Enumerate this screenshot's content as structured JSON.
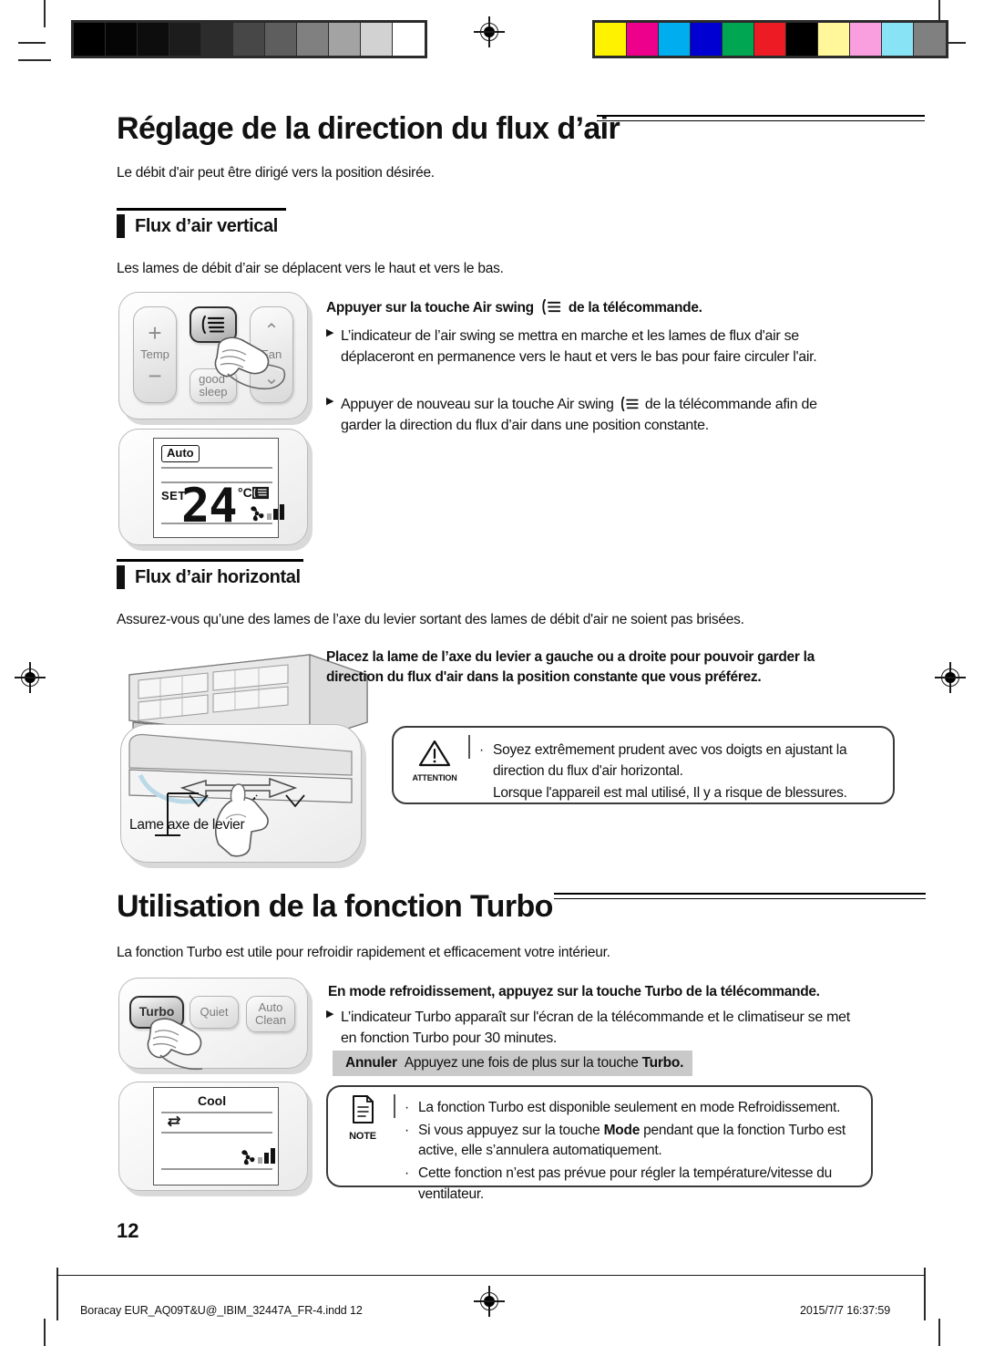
{
  "print_marks": {
    "grayscale_swatches": [
      "#000000",
      "#050505",
      "#0d0d0d",
      "#1c1c1c",
      "#2c2c2c",
      "#474747",
      "#5e5e5e",
      "#808080",
      "#a3a3a3",
      "#d2d2d2",
      "#ffffff"
    ],
    "color_swatches": [
      "#fff200",
      "#ec008c",
      "#00aeef",
      "#0000d2",
      "#00a651",
      "#ed1c24",
      "#000000",
      "#fff79a",
      "#f99fe0",
      "#88e3f5",
      "#808080"
    ],
    "registration_mark": "registration-target"
  },
  "sections": [
    {
      "id": "airflow",
      "title": "Réglage de la direction du flux d’air",
      "intro": "Le débit d'air peut être dirigé vers la position désirée."
    },
    {
      "id": "turbo",
      "title": "Utilisation de la fonction Turbo",
      "intro": "La fonction Turbo est utile pour refroidir rapidement et efficacement votre intérieur."
    }
  ],
  "vertical": {
    "heading": "Flux d’air vertical",
    "intro": "Les lames de débit d’air se déplacent vers le haut et vers le bas.",
    "lead_pre": "Appuyer sur la touche Air swing",
    "lead_post": "de la télécommande.",
    "bullets": [
      "L’indicateur de l’air swing se mettra en marche et les lames de flux d'air se déplaceront en permanence vers le haut et vers le bas pour faire circuler l'air.",
      "Appuyer de nouveau sur la touche Air swing ⦗≳ de la télécommande afin de garder la direction du flux d’air dans une position constante."
    ],
    "bullet2_pre": "Appuyer de nouveau sur la touche Air swing",
    "bullet2_post": "de la télécommande afin de garder la direction du flux d’air dans une position constante.",
    "remote": {
      "temp_label": "Temp",
      "plus": "+",
      "minus": "−",
      "airswing_icon": "air-swing-icon",
      "goodsleep_line1": "good’",
      "goodsleep_line2": "sleep",
      "fan_label": "Fan",
      "fan_up_icon": "chevron-up-icon",
      "fan_down_icon": "chevron-down-icon"
    },
    "lcd": {
      "mode": "Auto",
      "set_label": "SET",
      "temperature": "24",
      "unit": "°C",
      "swing_icon": "air-swing-icon",
      "fan_icon": "fan-icon",
      "fan_level_bars": 3
    }
  },
  "horizontal": {
    "heading": "Flux d’air horizontal",
    "intro": "Assurez-vous qu’une des lames de l’axe du levier sortant des lames de débit d'air ne soient pas brisées.",
    "lead": "Placez la lame de l’axe du levier a gauche ou a droite pour pouvoir garder la direction du flux d'air dans la position constante que vous préférez.",
    "diagram_label": "Lame axe de levier",
    "diagram_name": "air-conditioner-unit-illustration",
    "attention": {
      "icon": "warning-triangle-icon",
      "label": "ATTENTION",
      "items": [
        "Soyez extrêmement prudent avec vos doigts en ajustant la direction du flux d'air horizontal.",
        "Lorsque l'appareil est mal utilisé, Il y a risque de blessures."
      ]
    }
  },
  "turbo": {
    "lead": "En mode refroidissement, appuyez sur la touche Turbo de la télécommande.",
    "bullets": [
      "L’indicateur Turbo apparaît sur l'écran de la télécommande et le climatiseur se met en fonction Turbo pour 30 minutes."
    ],
    "annuler_label": "Annuler",
    "annuler_text_pre": "Appuyez une fois de plus sur la touche",
    "annuler_text_bold": "Turbo.",
    "remote": {
      "turbo": "Turbo",
      "quiet": "Quiet",
      "autoclean_line1": "Auto",
      "autoclean_line2": "Clean"
    },
    "lcd": {
      "mode": "Cool",
      "turbo_icon": "turbo-indicator-icon",
      "fan_icon": "fan-icon",
      "fan_level_bars": 3
    },
    "note": {
      "icon": "note-document-icon",
      "label": "NOTE",
      "items": [
        "La fonction Turbo est disponible seulement en mode Refroidissement.",
        "Si vous appuyez sur la touche Mode pendant que la fonction Turbo est active, elle s’annulera automatiquement.",
        "Cette fonction n’est pas prévue pour régler la température/vitesse du ventilateur."
      ],
      "item2_pre": "Si vous appuyez sur la touche",
      "item2_bold": "Mode",
      "item2_post": "pendant que la fonction Turbo est active, elle s’annulera automatiquement."
    }
  },
  "footer": {
    "page_number": "12",
    "file_name": "Boracay EUR_AQ09T&U@_IBIM_32447A_FR-4.indd   12",
    "timestamp": "2015/7/7   16:37:59"
  }
}
